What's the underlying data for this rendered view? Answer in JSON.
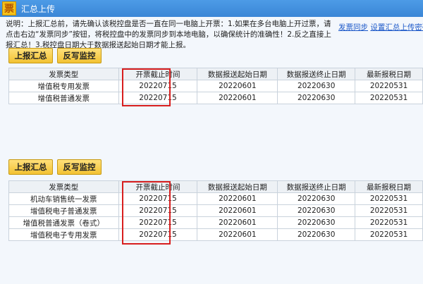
{
  "window": {
    "title": "汇总上传",
    "icon_glyph": "票"
  },
  "notice": "说明：上报汇总前，请先确认该税控盘是否一直在同一电脑上开票：1.如果在多台电脑上开过票，请点击右边“发票同步”按钮，将税控盘中的发票同步到本地电脑，以确保统计的准确性！2.反之直接上报汇总！3.税控盘日期大于数据报送起始日期才能上报。",
  "links": {
    "sync": "发票同步",
    "settings": "设置汇总上传密码"
  },
  "buttons": {
    "report": "上报汇总",
    "monitor": "反写监控"
  },
  "table_headers": [
    "发票类型",
    "开票截止时间",
    "数据报送起始日期",
    "数据报送终止日期",
    "最新报税日期"
  ],
  "table1": {
    "rows": [
      [
        "增值税专用发票",
        "20220715",
        "20220601",
        "20220630",
        "20220531"
      ],
      [
        "增值税普通发票",
        "20220715",
        "20220601",
        "20220630",
        "20220531"
      ]
    ]
  },
  "table2": {
    "rows": [
      [
        "机动车销售统一发票",
        "20220715",
        "20220601",
        "20220630",
        "20220531"
      ],
      [
        "增值税电子普通发票",
        "20220715",
        "20220601",
        "20220630",
        "20220531"
      ],
      [
        "增值税普通发票（卷式）",
        "20220715",
        "20220601",
        "20220630",
        "20220531"
      ],
      [
        "增值税电子专用发票",
        "20220715",
        "20220601",
        "20220630",
        "20220531"
      ]
    ]
  },
  "colors": {
    "titlebar": "#3a86d6",
    "button": "#f2c233",
    "highlight": "#d81e1e",
    "link": "#1a57c8"
  },
  "icons": {
    "app": "invoice-icon"
  }
}
